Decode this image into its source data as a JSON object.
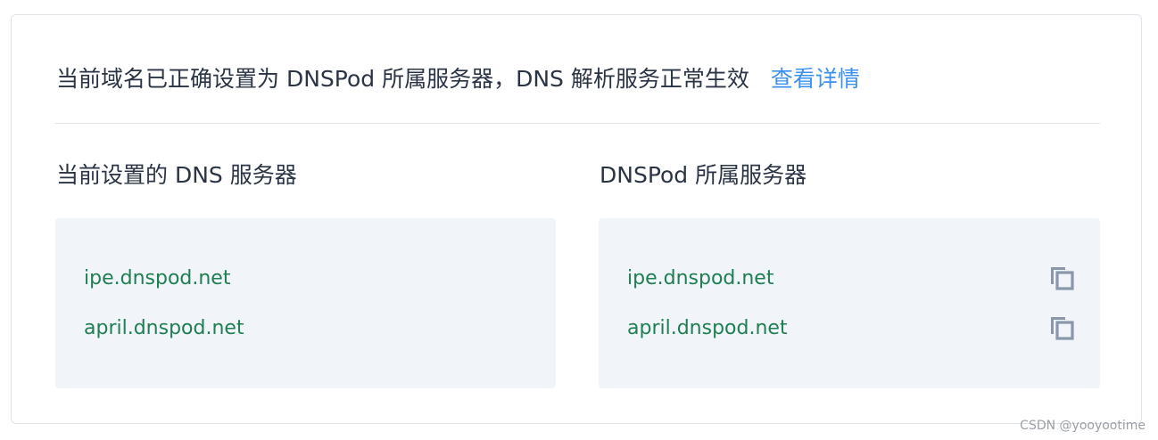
{
  "status": {
    "message": "当前域名已正确设置为 DNSPod 所属服务器，DNS 解析服务正常生效",
    "details_link": "查看详情"
  },
  "current_servers": {
    "title": "当前设置的 DNS 服务器",
    "items": [
      {
        "value": "ipe.dnspod.net"
      },
      {
        "value": "april.dnspod.net"
      }
    ]
  },
  "dnspod_servers": {
    "title": "DNSPod 所属服务器",
    "items": [
      {
        "value": "ipe.dnspod.net",
        "icon": "copy-icon"
      },
      {
        "value": "april.dnspod.net",
        "icon": "copy-icon"
      }
    ]
  },
  "watermark": "CSDN @yooyootime",
  "colors": {
    "text": "#2b3445",
    "link": "#3c91f0",
    "server": "#1e7f52",
    "panel": "#f1f4f9",
    "icon": "#8a97ab"
  }
}
